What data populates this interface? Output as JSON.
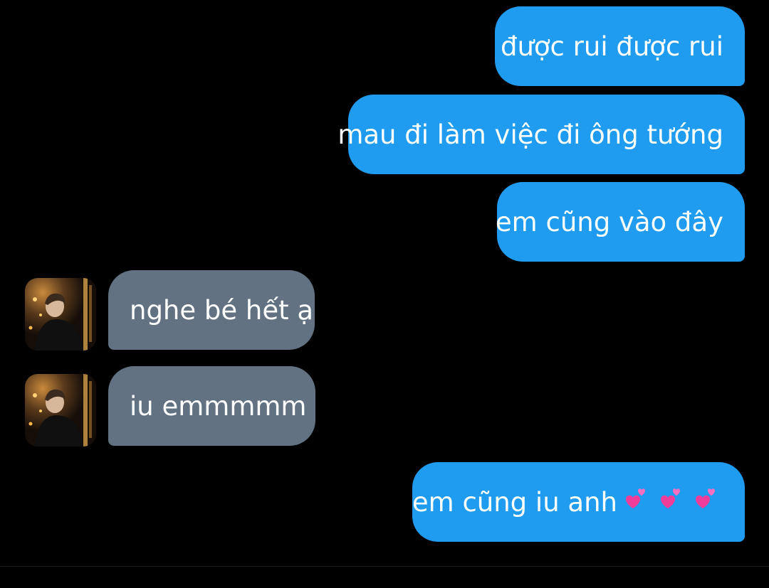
{
  "conversation": {
    "messages": [
      {
        "sender": "me",
        "text": "được rui được rui"
      },
      {
        "sender": "me",
        "text": "mau đi làm việc đi ông tướng"
      },
      {
        "sender": "me",
        "text": "em cũng vào đây"
      },
      {
        "sender": "other",
        "text": "nghe bé hết ạ",
        "avatar": "profile-photo"
      },
      {
        "sender": "other",
        "text": "iu emmmmm",
        "avatar": "profile-photo"
      },
      {
        "sender": "me",
        "text": "em cũng iu anh",
        "emoji": [
          "two-hearts-icon",
          "two-hearts-icon",
          "two-hearts-icon"
        ]
      }
    ]
  },
  "colors": {
    "background": "#000000",
    "sent_bubble": "#1f9cef",
    "received_bubble": "#627282",
    "text": "#ffffff",
    "heart": "#f03d9a"
  }
}
